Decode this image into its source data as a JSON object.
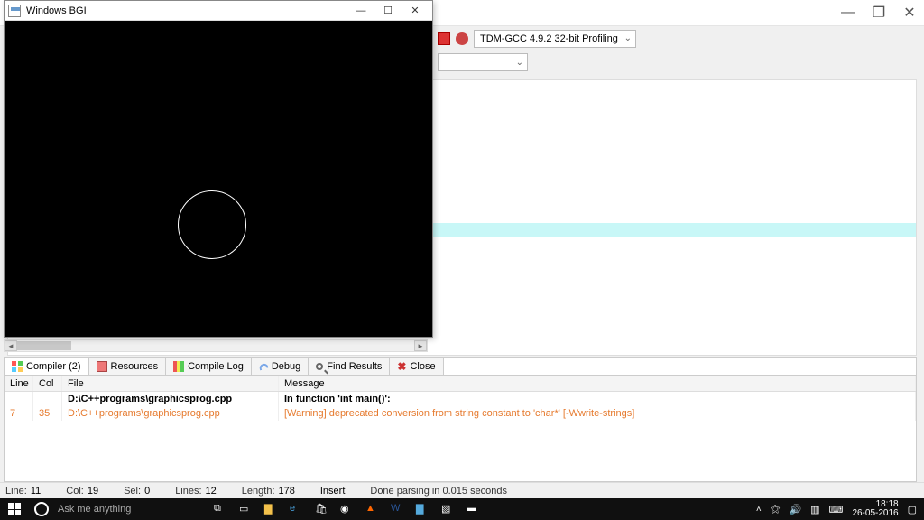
{
  "bgi_window": {
    "title": "Windows BGI",
    "minimize": "—",
    "maximize": "☐",
    "close": "✕"
  },
  "ide": {
    "win_min": "—",
    "win_max": "❐",
    "win_close": "✕",
    "compiler_profile": "TDM-GCC 4.9.2 32-bit Profiling"
  },
  "bottom_tabs": {
    "compiler": "Compiler (2)",
    "resources": "Resources",
    "compile_log": "Compile Log",
    "debug": "Debug",
    "find_results": "Find Results",
    "close": "Close"
  },
  "out": {
    "hdr_line": "Line",
    "hdr_col": "Col",
    "hdr_file": "File",
    "hdr_msg": "Message",
    "rows": [
      {
        "line": "",
        "col": "",
        "file": "D:\\C++programs\\graphicsprog.cpp",
        "msg": "In function 'int main()':"
      },
      {
        "line": "7",
        "col": "35",
        "file": "D:\\C++programs\\graphicsprog.cpp",
        "msg": "[Warning] deprecated conversion from string constant to 'char*' [-Wwrite-strings]"
      }
    ]
  },
  "status": {
    "line_l": "Line:",
    "line_v": "11",
    "col_l": "Col:",
    "col_v": "19",
    "sel_l": "Sel:",
    "sel_v": "0",
    "lines_l": "Lines:",
    "lines_v": "12",
    "len_l": "Length:",
    "len_v": "178",
    "mode": "Insert",
    "parse": "Done parsing in 0.015 seconds"
  },
  "taskbar": {
    "search_placeholder": "Ask me anything",
    "time": "18:18",
    "date": "26-05-2016"
  }
}
